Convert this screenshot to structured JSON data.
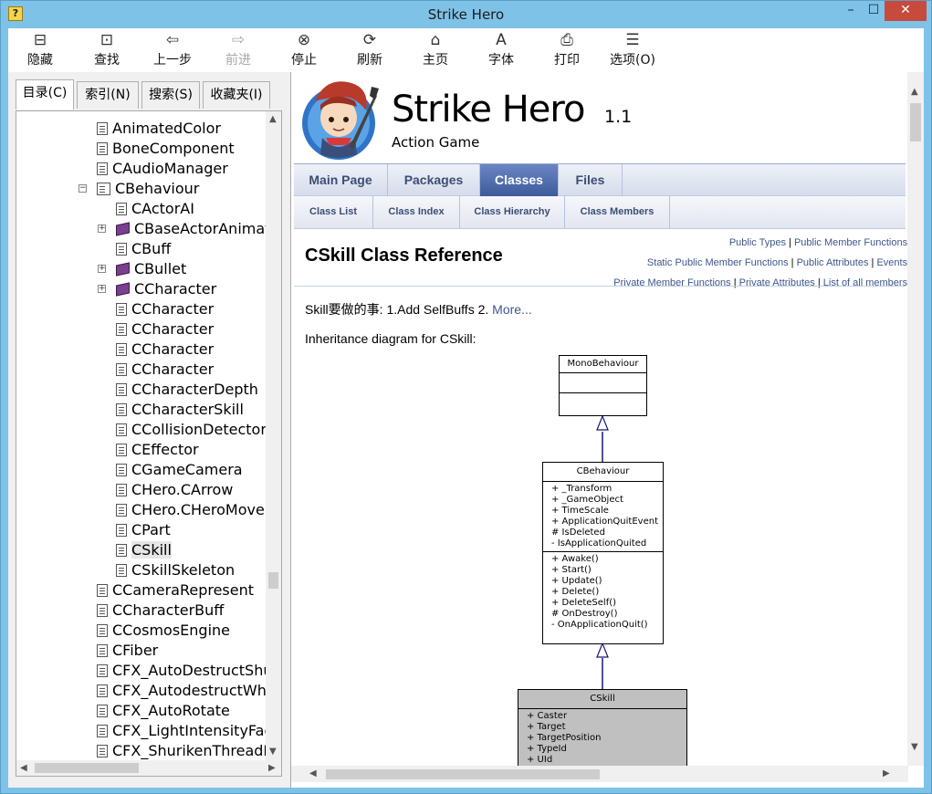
{
  "window": {
    "title": "Strike Hero",
    "app_icon": "help-book-icon",
    "minimize": "–",
    "maximize": "☐",
    "close": "✕"
  },
  "toolbar": [
    {
      "id": "hide",
      "label": "隐藏",
      "icon": "hide-pane-icon",
      "glyph": "⊟",
      "enabled": true
    },
    {
      "id": "locate",
      "label": "查找",
      "icon": "locate-icon",
      "glyph": "⊡",
      "enabled": true
    },
    {
      "id": "back",
      "label": "上一步",
      "icon": "back-arrow-icon",
      "glyph": "⇦",
      "enabled": true
    },
    {
      "id": "forward",
      "label": "前进",
      "icon": "forward-arrow-icon",
      "glyph": "⇨",
      "enabled": false
    },
    {
      "id": "stop",
      "label": "停止",
      "icon": "stop-icon",
      "glyph": "⊗",
      "enabled": true
    },
    {
      "id": "refresh",
      "label": "刷新",
      "icon": "refresh-icon",
      "glyph": "⟳",
      "enabled": true
    },
    {
      "id": "home",
      "label": "主页",
      "icon": "home-icon",
      "glyph": "⌂",
      "enabled": true
    },
    {
      "id": "font",
      "label": "字体",
      "icon": "font-icon",
      "glyph": "A",
      "enabled": true
    },
    {
      "id": "print",
      "label": "打印",
      "icon": "printer-icon",
      "glyph": "⎙",
      "enabled": true
    },
    {
      "id": "options",
      "label": "选项(O)",
      "icon": "options-icon",
      "glyph": "☰",
      "enabled": true
    }
  ],
  "left_tabs": [
    {
      "label": "目录(C)",
      "active": true
    },
    {
      "label": "索引(N)",
      "active": false
    },
    {
      "label": "搜索(S)",
      "active": false
    },
    {
      "label": "收藏夹(I)",
      "active": false
    }
  ],
  "tree": [
    {
      "label": "AnimatedColor",
      "level": 1,
      "icon": "page"
    },
    {
      "label": "BoneComponent",
      "level": 1,
      "icon": "page"
    },
    {
      "label": "CAudioManager",
      "level": 1,
      "icon": "page"
    },
    {
      "label": "CBehaviour",
      "level": 1,
      "icon": "open-book",
      "expander": "−"
    },
    {
      "label": "CActorAI",
      "level": 2,
      "icon": "page"
    },
    {
      "label": "CBaseActorAnimato",
      "level": 2,
      "icon": "book",
      "expander": "+"
    },
    {
      "label": "CBuff",
      "level": 2,
      "icon": "page"
    },
    {
      "label": "CBullet",
      "level": 2,
      "icon": "book",
      "expander": "+"
    },
    {
      "label": "CCharacter",
      "level": 2,
      "icon": "book",
      "expander": "+"
    },
    {
      "label": "CCharacter",
      "level": 2,
      "icon": "page"
    },
    {
      "label": "CCharacter",
      "level": 2,
      "icon": "page"
    },
    {
      "label": "CCharacter",
      "level": 2,
      "icon": "page"
    },
    {
      "label": "CCharacter",
      "level": 2,
      "icon": "page"
    },
    {
      "label": "CCharacterDepth",
      "level": 2,
      "icon": "page"
    },
    {
      "label": "CCharacterSkill",
      "level": 2,
      "icon": "page"
    },
    {
      "label": "CCollisionDetector",
      "level": 2,
      "icon": "page"
    },
    {
      "label": "CEffector",
      "level": 2,
      "icon": "page"
    },
    {
      "label": "CGameCamera",
      "level": 2,
      "icon": "page"
    },
    {
      "label": "CHero.CArrow",
      "level": 2,
      "icon": "page"
    },
    {
      "label": "CHero.CHeroMove",
      "level": 2,
      "icon": "page"
    },
    {
      "label": "CPart",
      "level": 2,
      "icon": "page"
    },
    {
      "label": "CSkill",
      "level": 2,
      "icon": "page",
      "selected": true
    },
    {
      "label": "CSkillSkeleton",
      "level": 2,
      "icon": "page"
    },
    {
      "label": "CCameraRepresent",
      "level": 1,
      "icon": "page"
    },
    {
      "label": "CCharacterBuff",
      "level": 1,
      "icon": "page"
    },
    {
      "label": "CCosmosEngine",
      "level": 1,
      "icon": "page"
    },
    {
      "label": "CFiber",
      "level": 1,
      "icon": "page"
    },
    {
      "label": "CFX_AutoDestructShu",
      "level": 1,
      "icon": "page"
    },
    {
      "label": "CFX_AutodestructWhe",
      "level": 1,
      "icon": "page"
    },
    {
      "label": "CFX_AutoRotate",
      "level": 1,
      "icon": "page"
    },
    {
      "label": "CFX_LightIntensityFad",
      "level": 1,
      "icon": "page"
    },
    {
      "label": "CFX_ShurikenThreadFi",
      "level": 1,
      "icon": "page"
    }
  ],
  "header": {
    "project_name": "Strike Hero",
    "project_number": "1.1",
    "project_brief": "Action Game",
    "logo": "hero-character-logo"
  },
  "nav_main": [
    {
      "label": "Main Page",
      "active": false
    },
    {
      "label": "Packages",
      "active": false
    },
    {
      "label": "Classes",
      "active": true
    },
    {
      "label": "Files",
      "active": false
    }
  ],
  "nav_sub": [
    {
      "label": "Class List"
    },
    {
      "label": "Class Index"
    },
    {
      "label": "Class Hierarchy"
    },
    {
      "label": "Class Members"
    }
  ],
  "summary_links": [
    [
      "Public Types",
      "Public Member Functions"
    ],
    [
      "Static Public Member Functions",
      "Public Attributes",
      "Events"
    ],
    [
      "Private Member Functions",
      "Private Attributes",
      "List of all members"
    ]
  ],
  "class_title": "CSkill Class Reference",
  "brief": {
    "text": "Skill要做的事: 1.Add SelfBuffs 2. ",
    "more": "More..."
  },
  "inheritance_title": "Inheritance diagram for CSkill:",
  "diagram": {
    "base": {
      "name": "MonoBehaviour",
      "attributes": [],
      "methods": []
    },
    "middle": {
      "name": "CBehaviour",
      "attributes": [
        "+ _Transform",
        "+ _GameObject",
        "+ TimeScale",
        "+ ApplicationQuitEvent",
        "# IsDeleted",
        "- IsApplicationQuited"
      ],
      "methods": [
        "+ Awake()",
        "+ Start()",
        "+ Update()",
        "+ Delete()",
        "+ DeleteSelf()",
        "# OnDestroy()",
        "- OnApplicationQuit()"
      ]
    },
    "current": {
      "name": "CSkill",
      "attributes": [
        "+ Caster",
        "+ Target",
        "+ TargetPosition",
        "+ TypeId",
        "+ UId"
      ]
    }
  }
}
